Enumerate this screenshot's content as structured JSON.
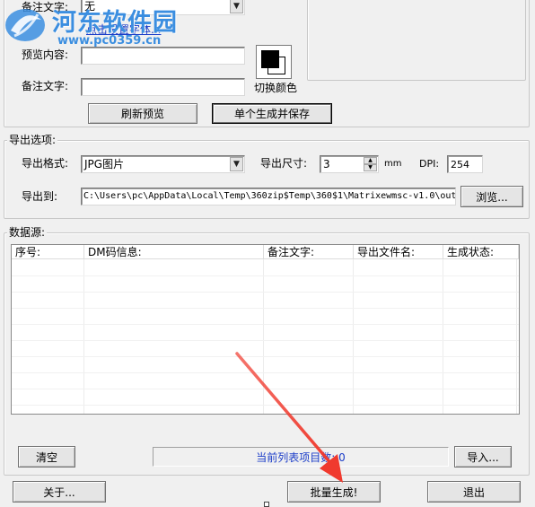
{
  "preview": {
    "remark_label_top": "备注文字:",
    "remark_select_value": "无",
    "set_font_link": "点击设置字体...",
    "preview_label": "预览内容:",
    "preview_value": "",
    "remark_label": "备注文字:",
    "remark_value": "",
    "switch_color_label": "切换颜色",
    "refresh_button": "刷新预览",
    "single_button": "单个生成并保存"
  },
  "export": {
    "group_title": "导出选项:",
    "format_label": "导出格式:",
    "format_value": "JPG图片",
    "size_label": "导出尺寸:",
    "size_value": "3",
    "size_unit": "mm",
    "dpi_label": "DPI:",
    "dpi_value": "254",
    "path_label": "导出到:",
    "path_value": "C:\\Users\\pc\\AppData\\Local\\Temp\\360zip$Temp\\360$1\\Matrixewmsc-v1.0\\out",
    "browse_button": "浏览..."
  },
  "datasource": {
    "group_title": "数据源:",
    "columns": [
      "序号:",
      "DM码信息:",
      "备注文字:",
      "导出文件名:",
      "生成状态:"
    ],
    "rows": [],
    "clear_button": "清空",
    "status_text": "当前列表项目数: 0",
    "import_button": "导入..."
  },
  "footer": {
    "about_button": "关于...",
    "batch_button": "批量生成!",
    "exit_button": "退出"
  },
  "watermark": {
    "title": "河东软件园",
    "url": "www.pc0359.cn"
  },
  "colors": {
    "link": "#1a3cc8",
    "arrow": "#f03a2e",
    "watermark": "#3b8ee0"
  }
}
